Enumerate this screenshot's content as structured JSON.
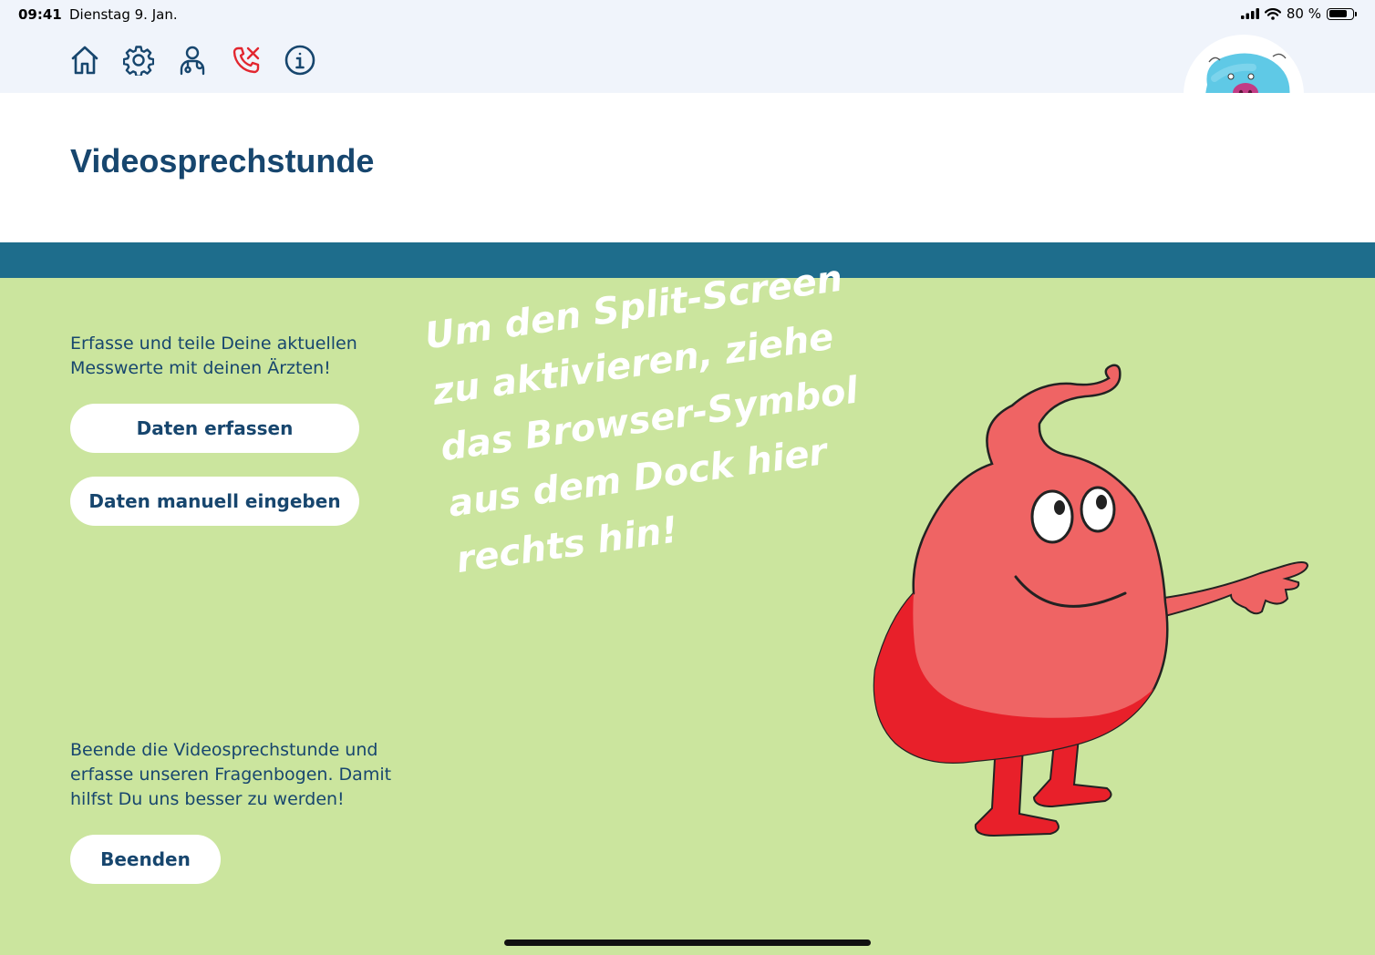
{
  "status_bar": {
    "time": "09:41",
    "date": "Dienstag 9. Jan.",
    "battery": "80 %",
    "battery_level": 0.8
  },
  "toolbar": {
    "items": [
      {
        "name": "home",
        "icon": "home-icon"
      },
      {
        "name": "settings",
        "icon": "gear-icon"
      },
      {
        "name": "doctor",
        "icon": "doctor-icon"
      },
      {
        "name": "hangup",
        "icon": "phone-hangup-icon"
      },
      {
        "name": "info",
        "icon": "info-icon"
      }
    ],
    "icon_color": "#17466e",
    "hangup_color": "#e2262f"
  },
  "header": {
    "title": "Videosprechstunde"
  },
  "content": {
    "intro_text": "Erfasse und teile Deine aktuellen Messwerte mit deinen Ärzten!",
    "capture_button": "Daten erfassen",
    "manual_button": "Daten manuell eingeben",
    "end_text": "Beende die Videosprechstunde und erfasse unseren Fragenbogen. Damit hilfst Du uns besser zu werden!",
    "end_button": "Beenden",
    "handwritten_lines": [
      "Um den Split-Screen",
      "zu aktivieren, ziehe",
      "das Browser-Symbol",
      "aus dem Dock hier",
      "rechts hin!"
    ]
  },
  "colors": {
    "navy": "#17466e",
    "teal_band": "#1e6d8c",
    "green_bg": "#cbe59e",
    "toolbar_bg": "#f0f4fb",
    "mascot_red": "#e8202a",
    "mascot_pink": "#ef6464",
    "avatar_blue": "#5fc9e6"
  }
}
